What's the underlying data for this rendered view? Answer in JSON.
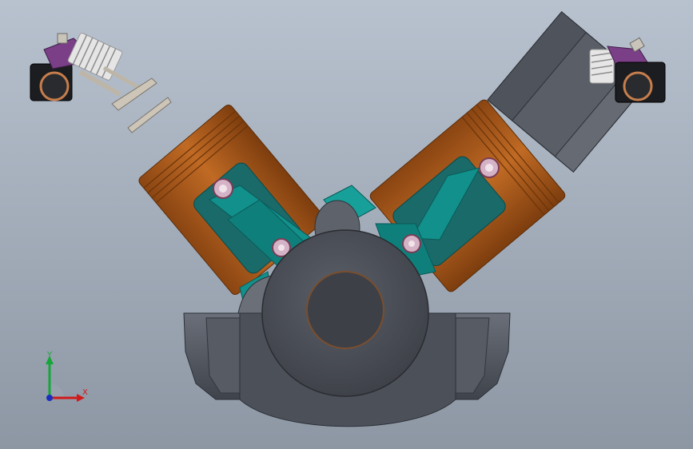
{
  "viewport": {
    "background_top": "#b8c2cf",
    "background_bottom": "#8d97a4"
  },
  "model": {
    "colors": {
      "piston": "#b5601d",
      "piston_dark": "#7a3c0b",
      "connecting_rod": "#0f8a86",
      "crankcase": "#4e535d",
      "crankshaft": "#3e424a",
      "cylinder_head": "#5a5e66",
      "rocker_arm": "#7a3f86",
      "valve": "#cdc5b8",
      "spring": "#d8d8d8",
      "bearing_ring": "#c77e4c"
    }
  },
  "triad": {
    "x_label": "X",
    "y_label": "Y",
    "x_color": "#d11a1a",
    "y_color": "#17a63a",
    "z_color": "#1b2fbf"
  }
}
